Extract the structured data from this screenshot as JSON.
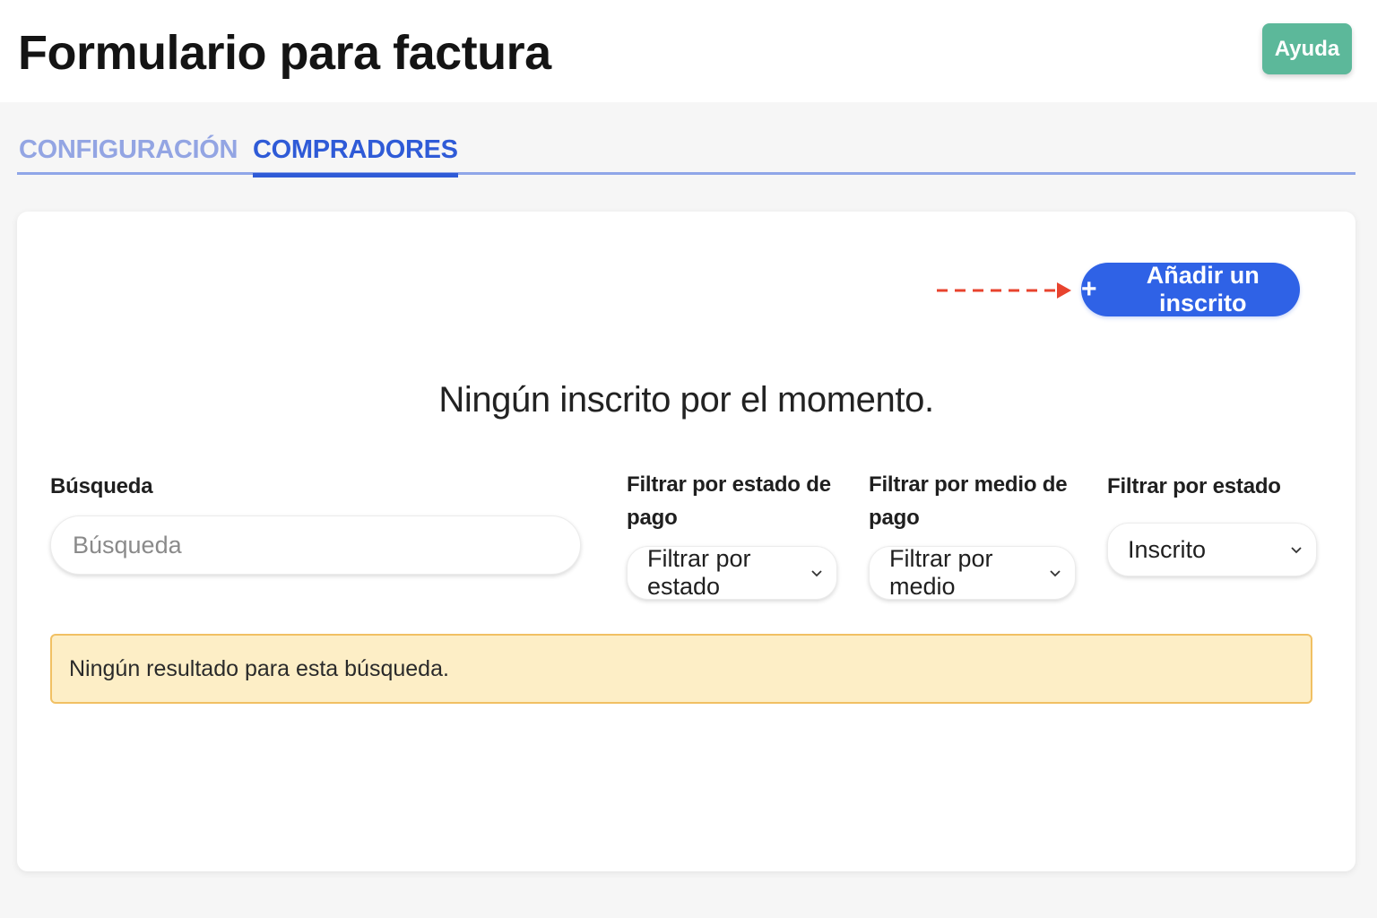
{
  "header": {
    "title": "Formulario para factura",
    "help_label": "Ayuda"
  },
  "tabs": [
    {
      "label": "CONFIGURACIÓN",
      "active": false
    },
    {
      "label": "COMPRADORES",
      "active": true
    }
  ],
  "main": {
    "add_button_label": "Añadir un inscrito",
    "add_button_icon": "plus-icon",
    "empty_message": "Ningún inscrito por el momento.",
    "search": {
      "label": "Búsqueda",
      "placeholder": "Búsqueda",
      "value": ""
    },
    "filter_payment_status": {
      "label_line1": "Filtrar por estado de",
      "label_line2": "pago",
      "selected": "Filtrar por estado"
    },
    "filter_payment_method": {
      "label_line1": "Filtrar por medio de",
      "label_line2": "pago",
      "selected": "Filtrar por medio"
    },
    "filter_status": {
      "label": "Filtrar por estado",
      "selected": "Inscrito"
    },
    "no_results": "Ningún resultado para esta búsqueda."
  },
  "colors": {
    "help_button": "#5cb89a",
    "primary": "#2f62e6",
    "active_tab": "#2f5bd7",
    "inactive_tab": "#93a5e3",
    "annotation_arrow": "#e8432e",
    "alert_background": "#fdeec6",
    "alert_border": "#f1c063"
  }
}
